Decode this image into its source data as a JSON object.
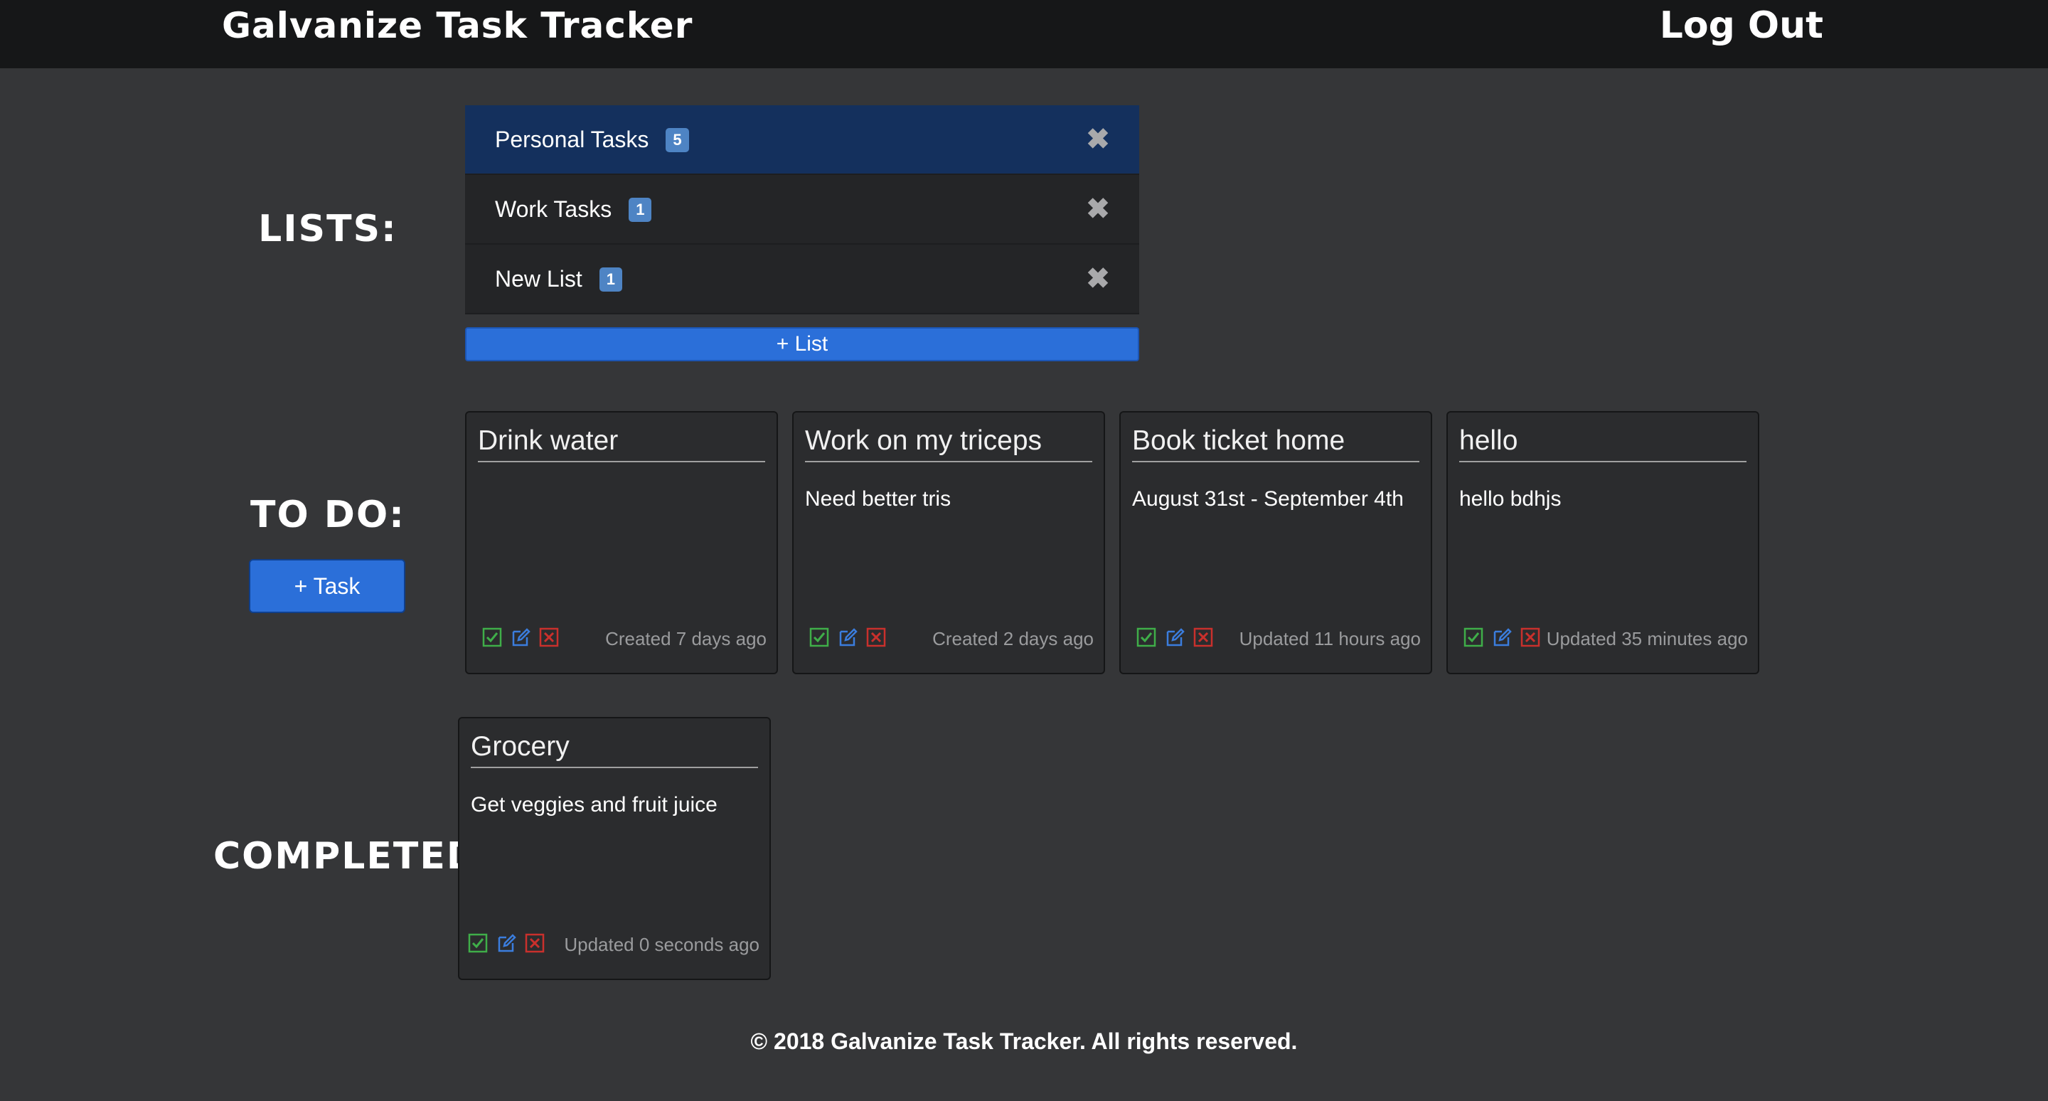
{
  "header": {
    "brand": "Galvanize Task Tracker",
    "logout_label": "Log Out"
  },
  "sections": {
    "lists_label": "LISTS:",
    "todo_label": "TO DO:",
    "completed_label": "COMPLETED:"
  },
  "lists": {
    "items": [
      {
        "name": "Personal Tasks",
        "count": "5",
        "active": true
      },
      {
        "name": "Work Tasks",
        "count": "1",
        "active": false
      },
      {
        "name": "New List",
        "count": "1",
        "active": false
      }
    ],
    "add_label": "+ List"
  },
  "todo": {
    "add_label": "+ Task",
    "tasks": [
      {
        "title": "Drink water",
        "body": "",
        "time": "Created 7 days ago"
      },
      {
        "title": "Work on my triceps",
        "body": "Need better tris",
        "time": "Created 2 days ago"
      },
      {
        "title": "Book ticket home",
        "body": "August 31st - September 4th",
        "time": "Updated 11 hours ago"
      },
      {
        "title": "hello",
        "body": "hello bdhjs",
        "time": "Updated 35 minutes ago"
      }
    ]
  },
  "completed": {
    "tasks": [
      {
        "title": "Grocery",
        "body": "Get veggies and fruit juice",
        "time": "Updated 0 seconds ago"
      }
    ]
  },
  "colors": {
    "background": "#353638",
    "navbar": "#161718",
    "active_list": "#14305d",
    "primary_button": "#2b6fd9",
    "complete_icon": "#3fae49",
    "edit_icon": "#3b7ddd",
    "delete_icon": "#c9302c"
  },
  "footer": {
    "text": "© 2018 Galvanize Task Tracker. All rights reserved."
  }
}
